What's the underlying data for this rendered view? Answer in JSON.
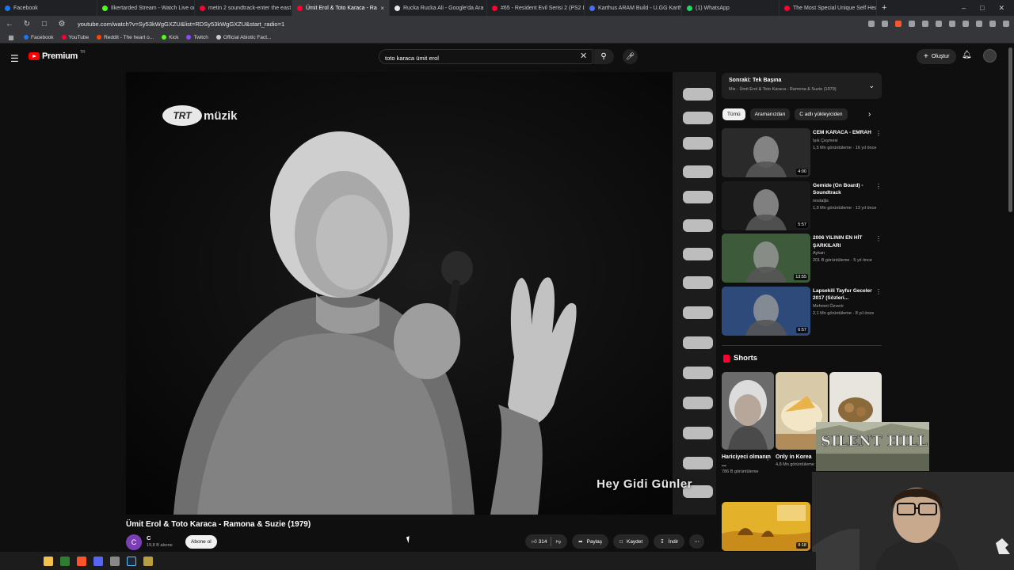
{
  "browser": {
    "tabs": [
      {
        "label": "Facebook",
        "color": "#1877f2"
      },
      {
        "label": "Ilkertarded Stream - Watch Live on K",
        "color": "#53fc18"
      },
      {
        "label": "metin 2 soundtrack-enter the east -",
        "color": "#ff0033"
      },
      {
        "label": "Ümit Erol & Toto Karaca - Ra",
        "color": "#ff0033",
        "active": true
      },
      {
        "label": "Rucka Rucka Ali - Google'da Ara",
        "color": "#e8e8e8"
      },
      {
        "label": "#65 - Resident Evil Serisi 2 (PS2 Döne",
        "color": "#ff0033"
      },
      {
        "label": "Karthus ARAM Build - U.GG Karthus",
        "color": "#4a6cf7"
      },
      {
        "label": "(1) WhatsApp",
        "color": "#25d366"
      },
      {
        "label": "The Most Special Unique Self Heatin",
        "color": "#ff0033"
      }
    ],
    "url": "youtube.com/watch?v=Sy53kWgGXZU&list=RDSy53kWgGXZU&start_radio=1",
    "bookmarks": [
      {
        "label": "Facebook",
        "color": "#1877f2"
      },
      {
        "label": "YouTube",
        "color": "#ff0033"
      },
      {
        "label": "Reddit - The heart o...",
        "color": "#ff4500"
      },
      {
        "label": "Kick",
        "color": "#53fc18"
      },
      {
        "label": "Twitch",
        "color": "#9146ff"
      },
      {
        "label": "Official Abiotic Fact...",
        "color": "#cccccc"
      }
    ]
  },
  "header": {
    "logo_text": "Premium",
    "logo_country": "TR",
    "search_value": "toto karaca ümit erol",
    "create_label": "Oluştur"
  },
  "video": {
    "overlay_logo": "TRT",
    "overlay_word": "müzik",
    "subtitle": "Hey Gidi Günler",
    "title": "Ümit Erol & Toto Karaca - Ramona & Suzie (1979)",
    "channel_initial": "C",
    "channel_name": "C",
    "channel_subs": "19,8 B abone",
    "subscribe_label": "Abone ol",
    "likes": "314",
    "share_label": "Paylaş",
    "save_label": "Kaydet",
    "download_label": "İndir"
  },
  "playlist": {
    "title": "Sonraki: Tek Başına",
    "subtitle": "Mix - Ümit Erol & Toto Karaca - Ramona & Suzie (1979)"
  },
  "chips": [
    "Tümü",
    "Aramanızdan",
    "C adlı yükleyiciden"
  ],
  "recommendations": [
    {
      "title": "CEM KARACA - EMRAH",
      "channel": "Işık Çeşmesi",
      "meta": "1,5 Mn görüntüleme · 16 yıl önce",
      "duration": "4:00",
      "thumb": "#2a2a2a"
    },
    {
      "title": "Gemide (On Board) - Soundtrack",
      "channel": "nostaljis",
      "meta": "1,9 Mn görüntüleme · 13 yıl önce",
      "duration": "5:57",
      "thumb": "#1a1a1a"
    },
    {
      "title": "2006 YILININ EN HİT ŞARKILARI",
      "channel": "Aykan",
      "meta": "201 B görüntüleme · 5 yıl önce",
      "duration": "13:55",
      "thumb": "#3d5a3a"
    },
    {
      "title": "Lapsekili Tayfur Geceler 2017 (Sözleri...",
      "channel": "Mehmet Özverir",
      "meta": "2,1 Mn görüntüleme · 8 yıl önce",
      "duration": "6:57",
      "thumb": "#2e4a7a"
    }
  ],
  "shorts": {
    "heading": "Shorts",
    "items": [
      {
        "title": "Hariciyeci olmanın ...",
        "views": "786 B görüntüleme"
      },
      {
        "title": "Only in Korea",
        "views": "4,8 Mn görüntüleme"
      }
    ]
  },
  "bottom_rec": {
    "duration": "8:18"
  },
  "overlay": {
    "game_title": "SILENT HILL"
  }
}
